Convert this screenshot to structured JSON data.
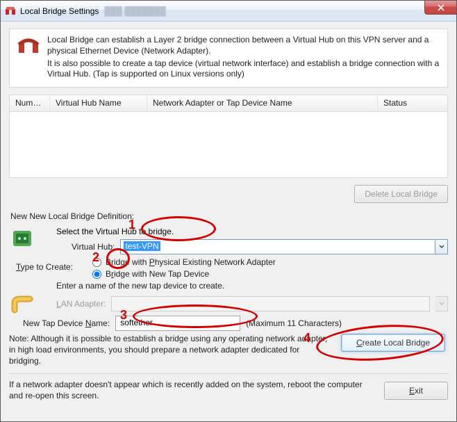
{
  "window": {
    "title": "Local Bridge Settings",
    "ghost": "███ ███████",
    "close_icon": "close-icon"
  },
  "intro": {
    "p1": "Local Bridge can establish a Layer 2 bridge connection between a Virtual Hub on this VPN server and a physical Ethernet Device (Network Adapter).",
    "p2": "It is also possible to create a tap device (virtual network interface) and establish a bridge connection with a Virtual Hub. (Tap is supported on Linux versions only)"
  },
  "table": {
    "headers": [
      "Numb...",
      "Virtual Hub Name",
      "Network Adapter or Tap Device Name",
      "Status"
    ],
    "rows": []
  },
  "buttons": {
    "delete": "Delete Local Bridge",
    "create": "Create Local Bridge",
    "exit": "Exit"
  },
  "definition": {
    "section_label": "New New Local Bridge Definition:",
    "select_label": "Select the Virtual Hub to bridge.",
    "virtual_hub_label": "Virtual Hub:",
    "virtual_hub_value": "test-VPN",
    "type_label": "Type to Create:",
    "radio_physical": "Bridge with Physical Existing Network Adapter",
    "radio_tap": "Bridge with New Tap Device",
    "selected_radio": "tap",
    "tap_instruction": "Enter a name of the new tap device to create.",
    "lan_label": "LAN Adapter:",
    "lan_value": "",
    "tap_name_label": "New Tap Device Name:",
    "tap_name_value": "softether",
    "tap_name_hint": "(Maximum 11 Characters)",
    "note": "Note: Although it is possible to establish a bridge using any operating network adapter, in high load environments, you should prepare a network adapter dedicated for bridging."
  },
  "footer": {
    "reboot_text": "If a network adapter doesn't appear which is recently added on the system, reboot the computer and re-open this screen."
  },
  "annotations": {
    "1": "1",
    "2": "2",
    "3": "3",
    "4": "4"
  }
}
